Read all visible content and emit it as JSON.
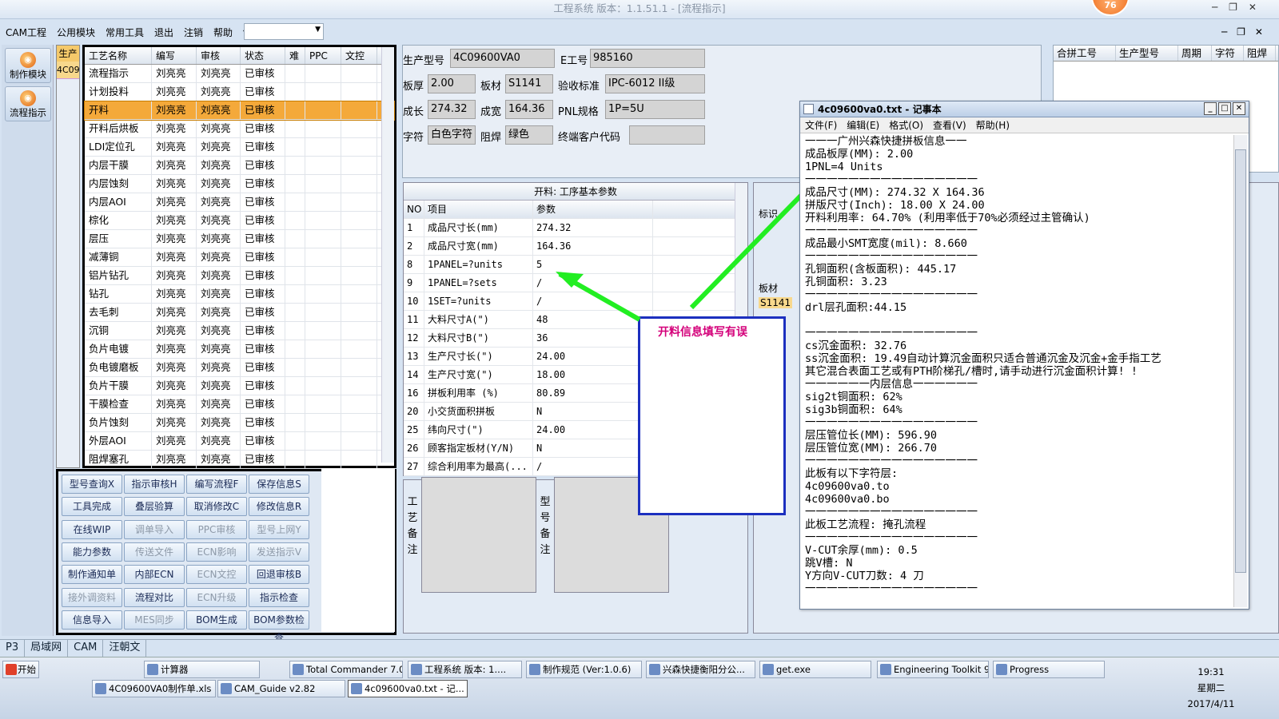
{
  "window": {
    "title": "工程系统  版本：1.1.51.1 - [流程指示]",
    "badge": "76"
  },
  "menubar": [
    "CAM工程",
    "公用模块",
    "常用工具",
    "退出",
    "注销",
    "帮助"
  ],
  "leftbar": [
    {
      "label": "制作模块"
    },
    {
      "label": "流程指示"
    }
  ],
  "side_col": {
    "header": "生产",
    "value": "4C09"
  },
  "process": {
    "headers": [
      "工艺名称",
      "编写",
      "审核",
      "状态",
      "难",
      "PPC",
      "文控"
    ],
    "rows": [
      [
        "流程指示",
        "刘亮亮",
        "刘亮亮",
        "已审核"
      ],
      [
        "计划投料",
        "刘亮亮",
        "刘亮亮",
        "已审核"
      ],
      [
        "开料",
        "刘亮亮",
        "刘亮亮",
        "已审核"
      ],
      [
        "开料后烘板",
        "刘亮亮",
        "刘亮亮",
        "已审核"
      ],
      [
        "LDI定位孔",
        "刘亮亮",
        "刘亮亮",
        "已审核"
      ],
      [
        "内层干膜",
        "刘亮亮",
        "刘亮亮",
        "已审核"
      ],
      [
        "内层蚀刻",
        "刘亮亮",
        "刘亮亮",
        "已审核"
      ],
      [
        "内层AOI",
        "刘亮亮",
        "刘亮亮",
        "已审核"
      ],
      [
        "棕化",
        "刘亮亮",
        "刘亮亮",
        "已审核"
      ],
      [
        "层压",
        "刘亮亮",
        "刘亮亮",
        "已审核"
      ],
      [
        "减薄铜",
        "刘亮亮",
        "刘亮亮",
        "已审核"
      ],
      [
        "铝片钻孔",
        "刘亮亮",
        "刘亮亮",
        "已审核"
      ],
      [
        "钻孔",
        "刘亮亮",
        "刘亮亮",
        "已审核"
      ],
      [
        "去毛刺",
        "刘亮亮",
        "刘亮亮",
        "已审核"
      ],
      [
        "沉铜",
        "刘亮亮",
        "刘亮亮",
        "已审核"
      ],
      [
        "负片电镀",
        "刘亮亮",
        "刘亮亮",
        "已审核"
      ],
      [
        "负电镀磨板",
        "刘亮亮",
        "刘亮亮",
        "已审核"
      ],
      [
        "负片干膜",
        "刘亮亮",
        "刘亮亮",
        "已审核"
      ],
      [
        "干膜检查",
        "刘亮亮",
        "刘亮亮",
        "已审核"
      ],
      [
        "负片蚀刻",
        "刘亮亮",
        "刘亮亮",
        "已审核"
      ],
      [
        "外层AOI",
        "刘亮亮",
        "刘亮亮",
        "已审核"
      ],
      [
        "阻焊塞孔",
        "刘亮亮",
        "刘亮亮",
        "已审核"
      ]
    ]
  },
  "buttons": [
    [
      "型号查询X",
      "指示审核H",
      "编写流程F",
      "保存信息S"
    ],
    [
      "工具完成",
      "叠层验算",
      "取消修改C",
      "修改信息R"
    ],
    [
      "在线WIP",
      "调单导入",
      "PPC审核",
      "型号上网Y"
    ],
    [
      "能力参数",
      "传送文件",
      "ECN影响",
      "发送指示V"
    ],
    [
      "制作通知单",
      "内部ECN",
      "ECN文控",
      "回退审核B"
    ],
    [
      "接外调资料",
      "流程对比",
      "ECN升级",
      "指示检查"
    ],
    [
      "信息导入",
      "MES同步",
      "BOM生成",
      "BOM参数检查"
    ]
  ],
  "form": {
    "生产型号": "4C09600VA0",
    "E工号": "985160",
    "板厚": "2.00",
    "板材": "S1141",
    "验收标准": "IPC-6012 II级",
    "成长": "274.32",
    "成宽": "164.36",
    "PNL规格": "1P=5U",
    "字符": "白色字符",
    "阻焊": "绿色",
    "终端客户代码": ""
  },
  "form_labels": {
    "生产型号": "生产型号",
    "E工号": "E工号",
    "板厚": "板厚",
    "板材": "板材",
    "验收标准": "验收标准",
    "成长": "成长",
    "成宽": "成宽",
    "PNL规格": "PNL规格",
    "字符": "字符",
    "阻焊": "阻焊",
    "终端客户代码": "终端客户代码"
  },
  "right_grid": {
    "headers": [
      "合拼工号",
      "生产型号",
      "周期",
      "字符",
      "阻焊"
    ]
  },
  "params": {
    "title": "开料: 工序基本参数",
    "headers": [
      "NO",
      "项目",
      "参数"
    ],
    "rows": [
      [
        "1",
        "成品尺寸长(mm)",
        "274.32"
      ],
      [
        "2",
        "成品尺寸宽(mm)",
        "164.36"
      ],
      [
        "8",
        "1PANEL=?units",
        "5"
      ],
      [
        "9",
        "1PANEL=?sets",
        "/"
      ],
      [
        "10",
        "1SET=?units",
        "/"
      ],
      [
        "11",
        "大料尺寸A(\")",
        "48"
      ],
      [
        "12",
        "大料尺寸B(\")",
        "36"
      ],
      [
        "13",
        "生产尺寸长(\")",
        "24.00"
      ],
      [
        "14",
        "生产尺寸宽(\")",
        "18.00"
      ],
      [
        "16",
        "拼板利用率 (%)",
        "80.89"
      ],
      [
        "20",
        "小交货面积拼板",
        "N"
      ],
      [
        "25",
        "纬向尺寸(\")",
        "24.00"
      ],
      [
        "26",
        "顾客指定板材(Y/N)",
        "N"
      ],
      [
        "27",
        "综合利用率为最高(...",
        "/"
      ]
    ]
  },
  "notes": {
    "left_label": "工艺备注",
    "right_label": "型号备注"
  },
  "rightlow": {
    "label1": "标识",
    "label2": "板材",
    "value2": "S1141"
  },
  "annotation": "开料信息填写有误",
  "notepad": {
    "title": "4c09600va0.txt - 记事本",
    "menu": [
      "文件(F)",
      "编辑(E)",
      "格式(O)",
      "查看(V)",
      "帮助(H)"
    ],
    "text": "一一一广州兴森快捷拼板信息一一\n成品板厚(MM): 2.00\n1PNL=4 Units\n一一一一一一一一一一一一一一一一\n成品尺寸(MM): 274.32 X 164.36\n拼版尺寸(Inch): 18.00 X 24.00\n开料利用率: 64.70% (利用率低于70%必须经过主管确认)\n一一一一一一一一一一一一一一一一\n成品最小SMT宽度(mil): 8.660\n一一一一一一一一一一一一一一一一\n孔铜面积(含板面积): 445.17\n孔铜面积: 3.23\n一一一一一一一一一一一一一一一一\ndrl层孔面积:44.15\n\n一一一一一一一一一一一一一一一一\ncs沉金面积: 32.76\nss沉金面积: 19.49自动计算沉金面积只适合普通沉金及沉金+金手指工艺\n其它混合表面工艺或有PTH阶梯孔/槽时,请手动进行沉金面积计算! !\n一一一一一一内层信息一一一一一一\nsig2t铜面积: 62%\nsig3b铜面积: 64%\n一一一一一一一一一一一一一一一一\n层压管位长(MM): 596.90\n层压管位宽(MM): 266.70\n一一一一一一一一一一一一一一一一\n此板有以下字符层:\n4c09600va0.to\n4c09600va0.bo\n一一一一一一一一一一一一一一一一\n此板工艺流程: 掩孔流程\n一一一一一一一一一一一一一一一一\nV-CUT余厚(mm): 0.5\n跳V槽: N\nY方向V-CUT刀数: 4 刀\n一一一一一一一一一一一一一一一一"
  },
  "statusbar": [
    "P3",
    "局域网",
    "CAM",
    "汪朝文"
  ],
  "taskbar": {
    "start": "开始",
    "row1": [
      "计算器",
      "Total Commander 7.0 ...",
      "工程系统  版本: 1....",
      "制作规范 (Ver:1.0.6)",
      "兴森快捷衡阳分公...",
      "get.exe",
      "Engineering Toolkit 9....",
      "Progress"
    ],
    "row2": [
      "4C09600VA0制作单.xls ...",
      "CAM_Guide v2.82",
      "4c09600va0.txt - 记..."
    ],
    "time": "19:31",
    "weekday": "星期二",
    "date": "2017/4/11"
  },
  "colors": {
    "selected_row": "#f4a93a",
    "annotation_text": "#d4007a",
    "annotation_border": "#1c2fbf",
    "arrow": "#22ee22"
  }
}
